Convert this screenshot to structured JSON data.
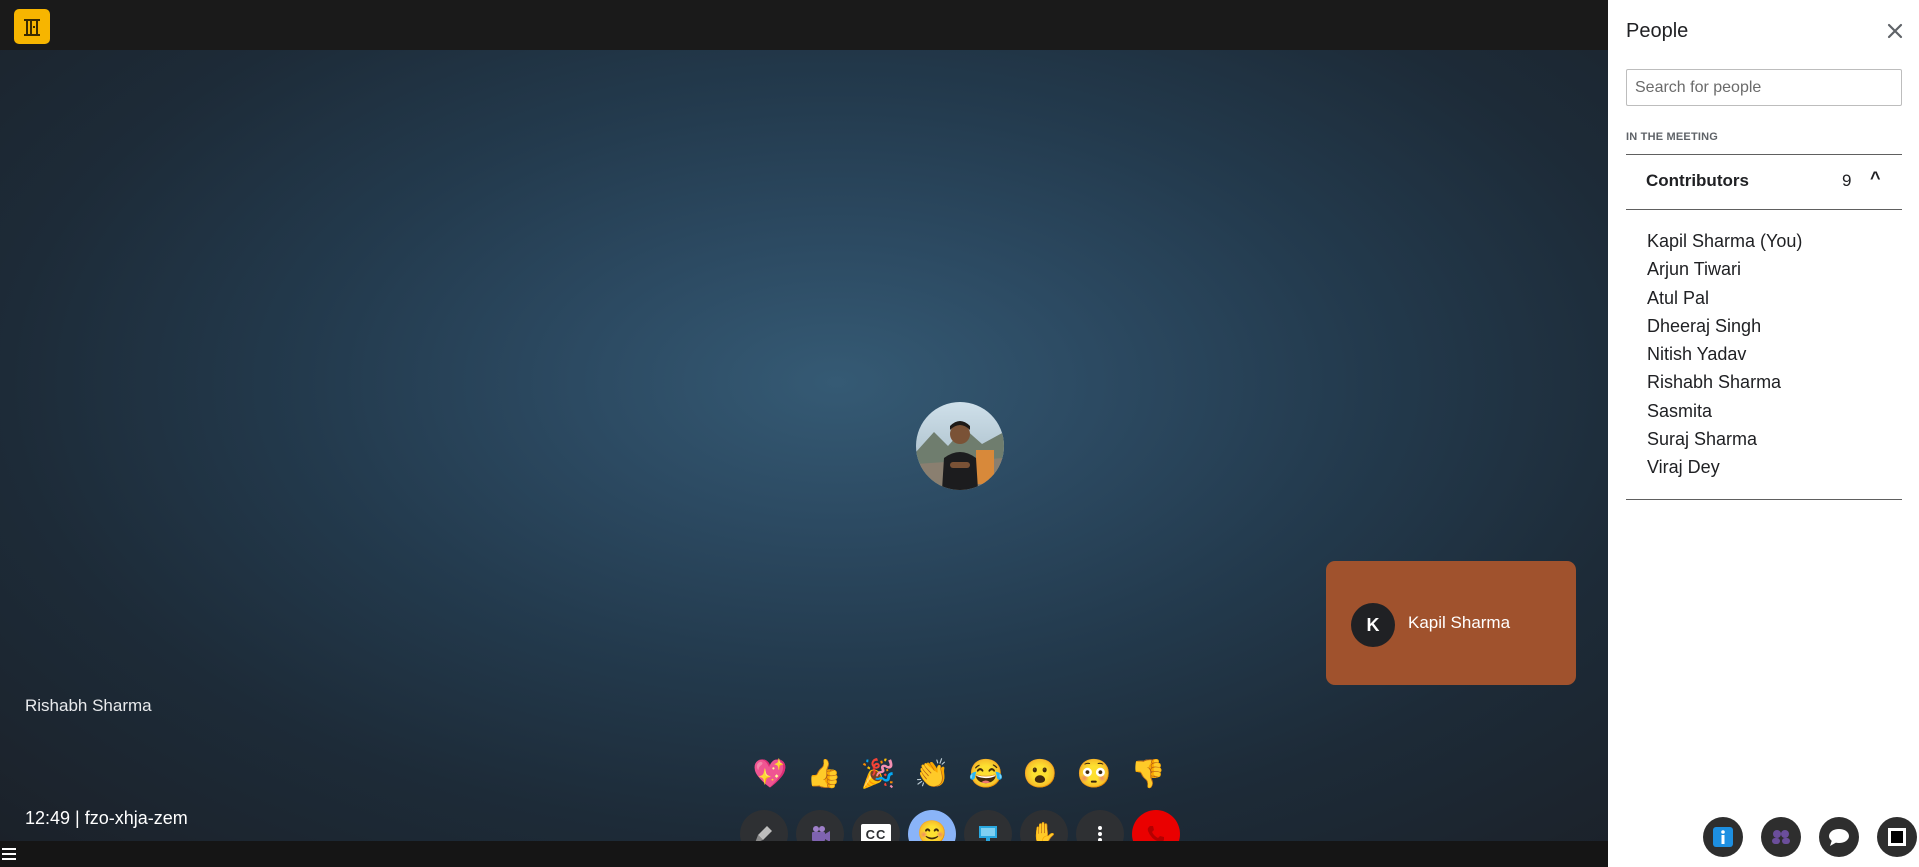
{
  "header": {
    "logo_icon": "door-logo-icon"
  },
  "stage": {
    "active_speaker": "Rishabh Sharma",
    "meeting_info": "12:49 | fzo-xhja-zem",
    "self_tile": {
      "initial": "K",
      "name": "Kapil Sharma"
    }
  },
  "reactions": [
    {
      "name": "sparkling-heart-icon",
      "glyph": "💖"
    },
    {
      "name": "thumbs-up-icon",
      "glyph": "👍"
    },
    {
      "name": "party-popper-icon",
      "glyph": "🎉"
    },
    {
      "name": "clapping-hands-icon",
      "glyph": "👏"
    },
    {
      "name": "tears-of-joy-icon",
      "glyph": "😂"
    },
    {
      "name": "surprised-face-icon",
      "glyph": "😮"
    },
    {
      "name": "flushed-face-icon",
      "glyph": "😳"
    },
    {
      "name": "thumbs-down-icon",
      "glyph": "👎"
    }
  ],
  "controls": {
    "mic_icon": "microphone-icon",
    "camera_icon": "camera-icon",
    "captions_label": "CC",
    "emoji_icon": "smiley-icon",
    "present_icon": "present-screen-icon",
    "hand_icon": "raise-hand-icon",
    "more_icon": "more-options-icon",
    "end_icon": "end-call-icon"
  },
  "people_panel": {
    "title": "People",
    "search_placeholder": "Search for people",
    "section_label": "IN THE MEETING",
    "group": {
      "label": "Contributors",
      "count": "9",
      "chevron": "^"
    },
    "people": [
      "Kapil Sharma (You)",
      "Arjun Tiwari",
      "Atul Pal",
      "Dheeraj Singh",
      "Nitish Yadav",
      "Rishabh Sharma",
      "Sasmita",
      "Suraj Sharma",
      "Viraj Dey"
    ]
  },
  "panel_buttons": [
    "info-icon",
    "people-icon",
    "chat-icon",
    "activities-icon"
  ],
  "colors": {
    "self_tile": "#a0522d",
    "end_call": "#ea0000",
    "emoji_active": "#8ab4f8",
    "logo": "#f7b500"
  }
}
